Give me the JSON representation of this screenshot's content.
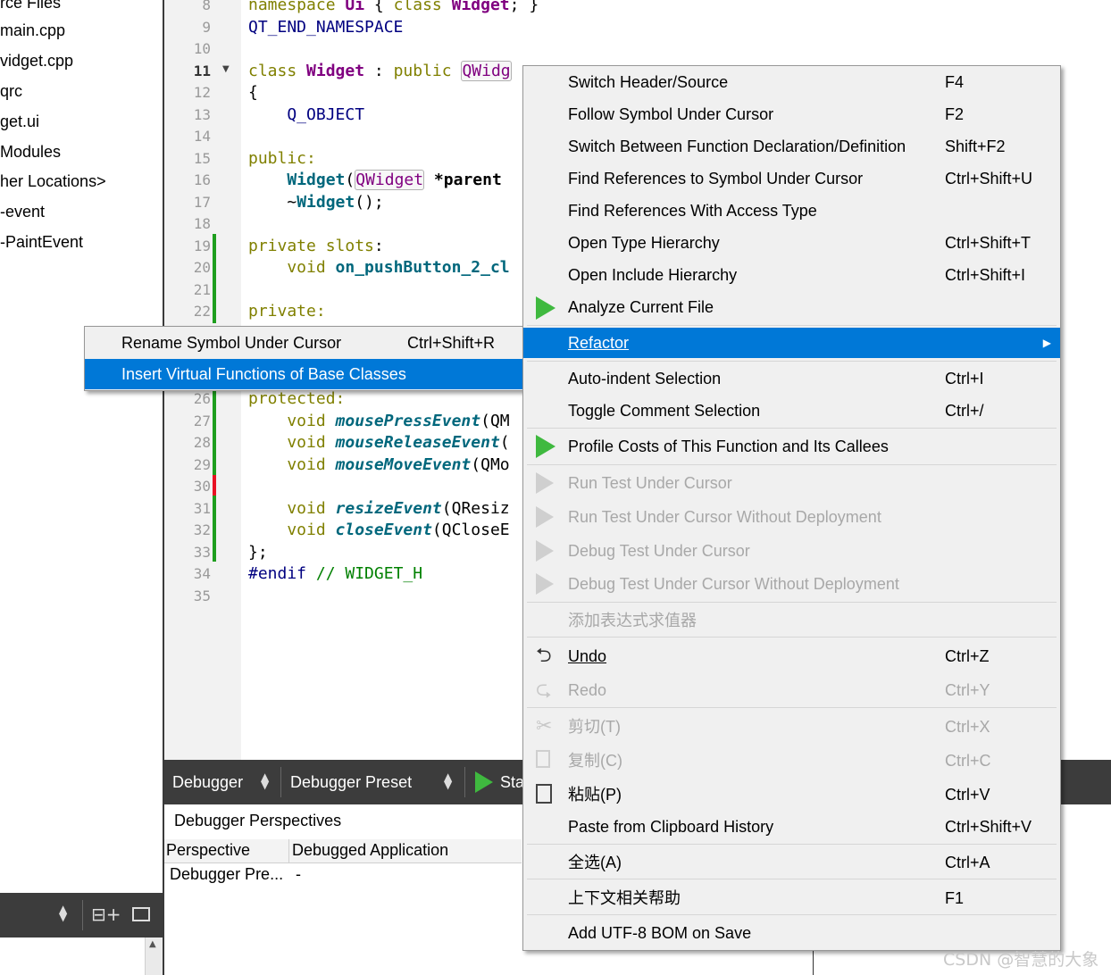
{
  "project_tree": {
    "items": [
      "rce Files",
      "main.cpp",
      "vidget.cpp",
      "qrc",
      "get.ui",
      " Modules",
      "her Locations>",
      "-event",
      "-PaintEvent"
    ]
  },
  "editor": {
    "line_numbers": [
      "8",
      "9",
      "10",
      "11",
      "12",
      "13",
      "14",
      "15",
      "16",
      "17",
      "18",
      "19",
      "20",
      "21",
      "22",
      "26",
      "27",
      "28",
      "29",
      "30",
      "31",
      "32",
      "33",
      "34",
      "35"
    ],
    "lines": {
      "l8a": "namespace ",
      "l8b": "Ui",
      "l8c": " { ",
      "l8d": "class ",
      "l8e": "Widget",
      "l8f": "; }",
      "l9": "QT_END_NAMESPACE",
      "l11a": "class ",
      "l11b": "Widget",
      "l11c": " : ",
      "l11d": "public ",
      "l11e": "QWidg",
      "l12": "{",
      "l13": "    Q_OBJECT",
      "l15": "public:",
      "l16a": "    ",
      "l16b": "Widget",
      "l16c": "(",
      "l16d": "QWidget",
      "l16e": " *parent",
      "l17a": "    ~",
      "l17b": "Widget",
      "l17c": "();",
      "l19a": "private ",
      "l19b": "slots",
      "l19c": ":",
      "l20a": "    void ",
      "l20b": "on_pushButton_2_cl",
      "l22": "private:",
      "l26": "protected:",
      "l27a": "    void ",
      "l27b": "mousePressEvent",
      "l27c": "(QM",
      "l28a": "    void ",
      "l28b": "mouseReleaseEvent",
      "l28c": "(",
      "l29a": "    void ",
      "l29b": "mouseMoveEvent",
      "l29c": "(QMo",
      "l31a": "    void ",
      "l31b": "resizeEvent",
      "l31c": "(QResiz",
      "l32a": "    void ",
      "l32b": "closeEvent",
      "l32c": "(QCloseE",
      "l33": "};",
      "l34a": "#endif",
      "l34b": " // WIDGET_H"
    },
    "current_line": "11"
  },
  "refactor_submenu": {
    "items": [
      {
        "label": "Rename Symbol Under Cursor",
        "shortcut": "Ctrl+Shift+R"
      },
      {
        "label": "Insert Virtual Functions of Base Classes",
        "shortcut": ""
      }
    ]
  },
  "context_menu": {
    "items": [
      {
        "label": "Switch Header/Source",
        "shortcut": "F4"
      },
      {
        "label": "Follow Symbol Under Cursor",
        "shortcut": "F2"
      },
      {
        "label": "Switch Between Function Declaration/Definition",
        "shortcut": "Shift+F2"
      },
      {
        "label": "Find References to Symbol Under Cursor",
        "shortcut": "Ctrl+Shift+U"
      },
      {
        "label": "Find References With Access Type",
        "shortcut": ""
      },
      {
        "label": "Open Type Hierarchy",
        "shortcut": "Ctrl+Shift+T"
      },
      {
        "label": "Open Include Hierarchy",
        "shortcut": "Ctrl+Shift+I"
      },
      {
        "label": "Analyze Current File",
        "shortcut": ""
      },
      {
        "label": "Refactor",
        "shortcut": ""
      },
      {
        "label": "Auto-indent Selection",
        "shortcut": "Ctrl+I"
      },
      {
        "label": "Toggle Comment Selection",
        "shortcut": "Ctrl+/"
      },
      {
        "label": "Profile Costs of This Function and Its Callees",
        "shortcut": ""
      },
      {
        "label": "Run Test Under Cursor",
        "shortcut": ""
      },
      {
        "label": "Run Test Under Cursor Without Deployment",
        "shortcut": ""
      },
      {
        "label": "Debug Test Under Cursor",
        "shortcut": ""
      },
      {
        "label": "Debug Test Under Cursor Without Deployment",
        "shortcut": ""
      },
      {
        "label": "添加表达式求值器",
        "shortcut": ""
      },
      {
        "label": "Undo",
        "shortcut": "Ctrl+Z"
      },
      {
        "label": "Redo",
        "shortcut": "Ctrl+Y"
      },
      {
        "label": "剪切(T)",
        "shortcut": "Ctrl+X"
      },
      {
        "label": "复制(C)",
        "shortcut": "Ctrl+C"
      },
      {
        "label": "粘贴(P)",
        "shortcut": "Ctrl+V"
      },
      {
        "label": "Paste from Clipboard History",
        "shortcut": "Ctrl+Shift+V"
      },
      {
        "label": "全选(A)",
        "shortcut": "Ctrl+A"
      },
      {
        "label": "上下文相关帮助",
        "shortcut": "F1"
      },
      {
        "label": "Add UTF-8 BOM on Save",
        "shortcut": ""
      }
    ]
  },
  "debugger": {
    "mode_label": "Debugger",
    "preset_label": "Debugger Preset",
    "start_label": "Sta",
    "perspectives_title": "Debugger Perspectives",
    "col_perspective": "Perspective",
    "col_application": "Debugged Application",
    "row_perspective": "Debugger Pre...",
    "row_application": "-"
  },
  "watermark": "CSDN @智慧的大象",
  "colors": {
    "selection": "#0078d7",
    "change_marker": "#1e9e1e",
    "error_marker": "#e81123"
  }
}
